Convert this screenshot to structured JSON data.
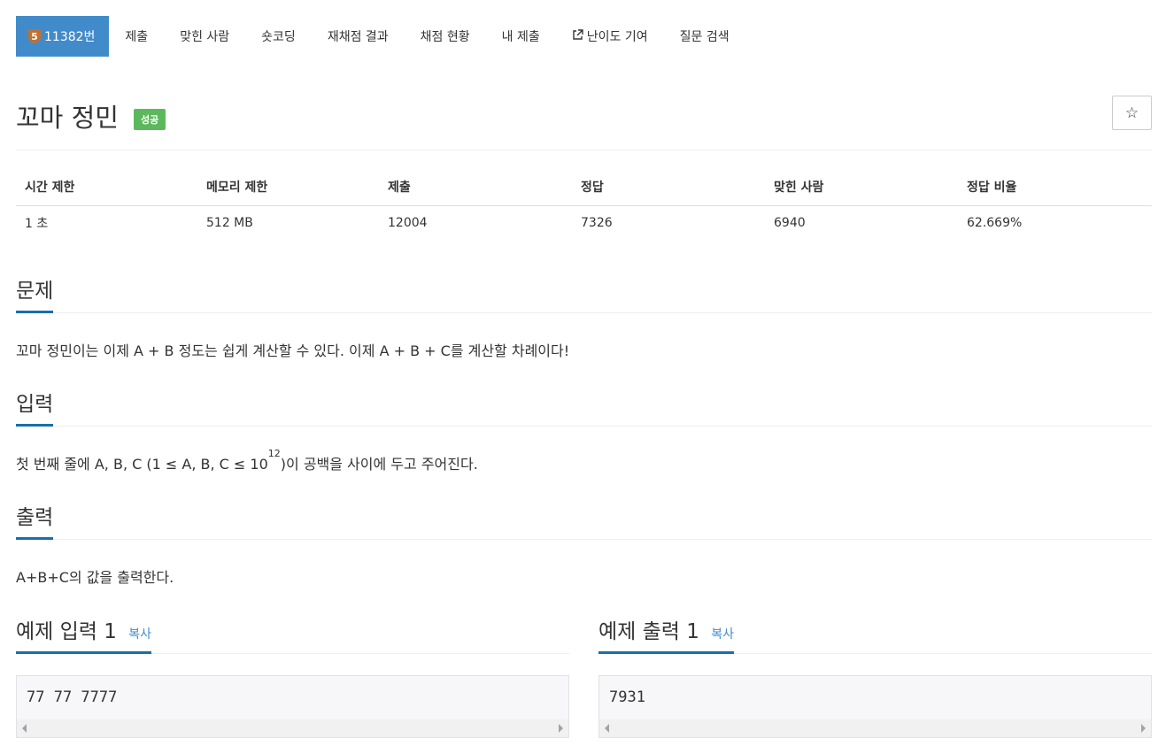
{
  "nav": {
    "problem_tab": {
      "tier": "5",
      "label": "11382번"
    },
    "items": [
      "제출",
      "맞힌 사람",
      "숏코딩",
      "재채점 결과",
      "채점 현황",
      "내 제출",
      "난이도 기여",
      "질문 검색"
    ]
  },
  "title": "꼬마 정민",
  "result_badge": "성공",
  "star_label": "☆",
  "info": {
    "headers": [
      "시간 제한",
      "메모리 제한",
      "제출",
      "정답",
      "맞힌 사람",
      "정답 비율"
    ],
    "values": [
      "1 초",
      "512 MB",
      "12004",
      "7326",
      "6940",
      "62.669%"
    ]
  },
  "sections": {
    "problem": {
      "title": "문제",
      "text": "꼬마 정민이는 이제 A + B 정도는 쉽게 계산할 수 있다. 이제 A + B + C를 계산할 차례이다!"
    },
    "input": {
      "title": "입력",
      "text_before": "첫 번째 줄에 A, B, C (1 ≤ A, B, C ≤ 10",
      "sup": "12",
      "text_after": ")이 공백을 사이에 두고 주어진다."
    },
    "output": {
      "title": "출력",
      "text": "A+B+C의 값을 출력한다."
    }
  },
  "samples": {
    "input": {
      "title": "예제 입력 1",
      "copy": "복사",
      "content": "77 77 7777"
    },
    "output": {
      "title": "예제 출력 1",
      "copy": "복사",
      "content": "7931"
    }
  },
  "colors": {
    "accent": "#428bca",
    "success": "#5cb85c",
    "tier": "#c2702e",
    "underline": "#1a6eaa"
  }
}
